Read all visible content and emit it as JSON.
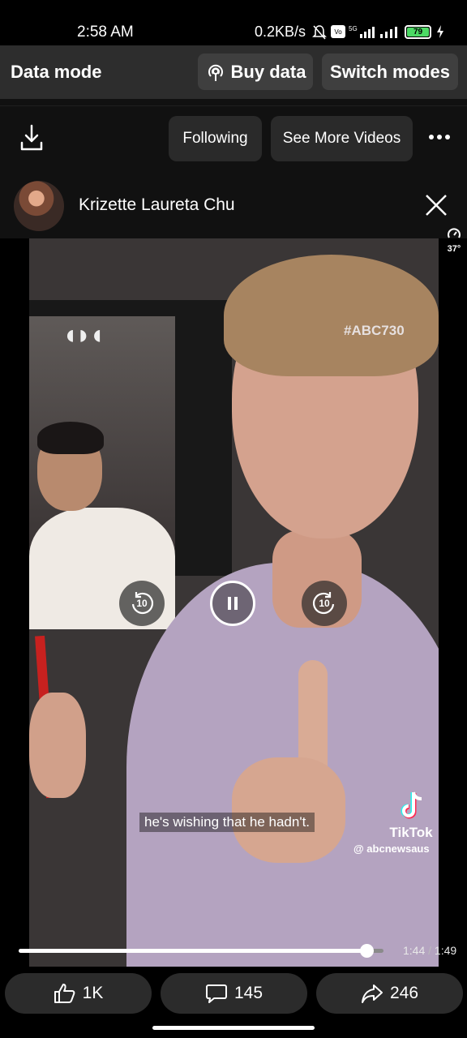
{
  "status_bar": {
    "time": "2:58 AM",
    "network_speed": "0.2KB/s",
    "battery": "79",
    "icons": [
      "bell-off-icon",
      "volte-icon",
      "signal-5g-icon",
      "signal-icon",
      "battery-icon",
      "charging-icon"
    ]
  },
  "data_bar": {
    "mode_label": "Data mode",
    "buy_label": "Buy data",
    "switch_label": "Switch modes"
  },
  "toolbar": {
    "following_label": "Following",
    "see_more_label": "See More Videos"
  },
  "author": {
    "name": "Krizette Laureta Chu"
  },
  "speed_indicator": {
    "value": "37°"
  },
  "video": {
    "hashtag": "#ABC730",
    "subtitle": "he's wishing that he hadn't.",
    "watermark_label": "TikTok",
    "watermark_handle": "@ abcnewsaus",
    "skip_seconds": "10"
  },
  "playback": {
    "current_time": "1:44",
    "separator": "/",
    "duration": "1:49",
    "progress_fraction": 0.954
  },
  "reactions": {
    "likes": "1K",
    "comments": "145",
    "shares": "246"
  },
  "colors": {
    "background": "#000000",
    "data_bar": "#2d2d2d",
    "pill": "#3f3f3f",
    "reaction_pill": "#2b2b2b"
  }
}
